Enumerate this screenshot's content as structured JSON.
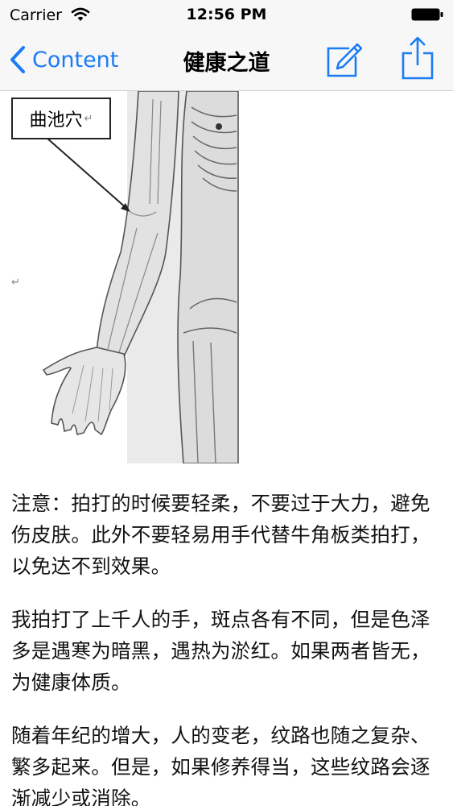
{
  "status_bar": {
    "carrier": "Carrier",
    "time": "12:56 PM"
  },
  "nav": {
    "back_label": "Content",
    "title": "健康之道",
    "edit_icon": "compose-icon",
    "share_icon": "share-icon",
    "tint": "#1a7cf6"
  },
  "figure": {
    "label": "曲池穴",
    "return_mark": "↵",
    "para_mark": "↵"
  },
  "article": {
    "paragraphs": [
      "注意：拍打的时候要轻柔，不要过于大力，避免伤皮肤。此外不要轻易用手代替牛角板类拍打，以免达不到效果。",
      "我拍打了上千人的手，斑点各有不同，但是色泽多是遇寒为暗黑，遇热为淤红。如果两者皆无，为健康体质。",
      "随着年纪的增大，人的变老，纹路也随之复杂、繁多起来。但是，如果修养得当，这些纹路会逐渐减少或消除。"
    ]
  }
}
